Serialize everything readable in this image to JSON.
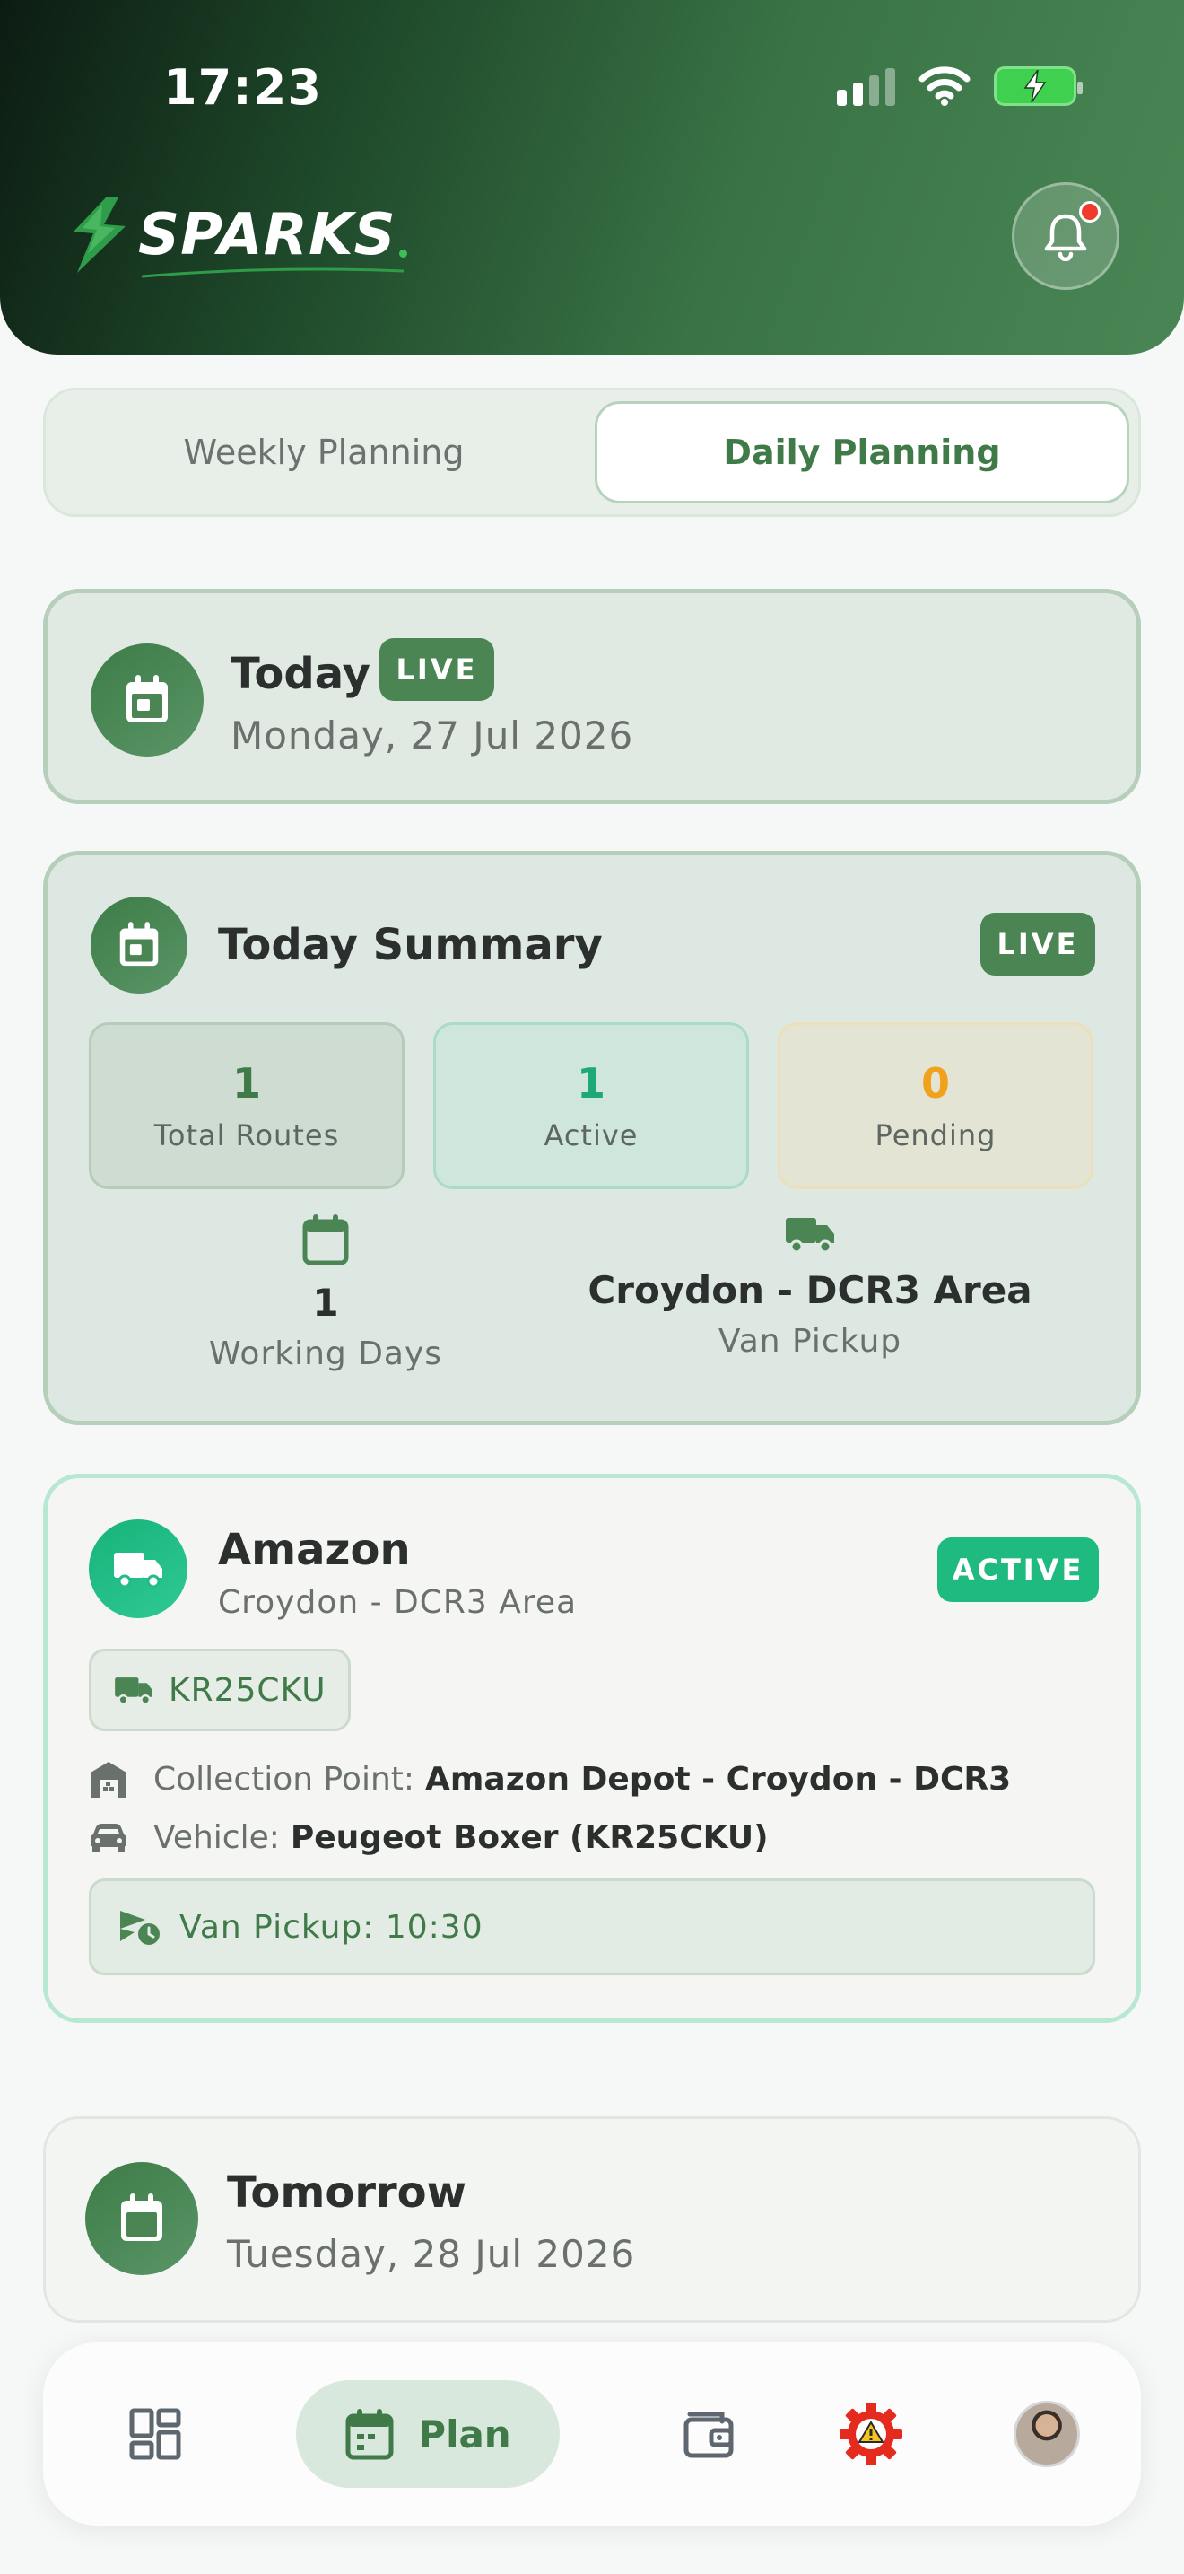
{
  "status_bar": {
    "time": "17:23"
  },
  "header": {
    "logo_text": "SPARKS",
    "has_notification": true
  },
  "tabs": [
    {
      "label": "Weekly Planning",
      "selected": false
    },
    {
      "label": "Daily Planning",
      "selected": true
    }
  ],
  "today": {
    "title": "Today",
    "badge": "LIVE",
    "date": "Monday, 27 Jul 2026"
  },
  "summary": {
    "title": "Today Summary",
    "badge": "LIVE",
    "stats": [
      {
        "value": "1",
        "label": "Total Routes",
        "color": "#3f7a48"
      },
      {
        "value": "1",
        "label": "Active",
        "color": "#1fa877"
      },
      {
        "value": "0",
        "label": "Pending",
        "color": "#f0a21c"
      }
    ],
    "working_days": {
      "value": "1",
      "label": "Working Days"
    },
    "van_pickup": {
      "value": "Croydon - DCR3 Area",
      "label": "Van Pickup"
    }
  },
  "route": {
    "company": "Amazon",
    "area": "Croydon - DCR3 Area",
    "status": "ACTIVE",
    "plate": "KR25CKU",
    "collection_label": "Collection Point:",
    "collection_value": "Amazon Depot - Croydon - DCR3",
    "vehicle_label": "Vehicle:",
    "vehicle_value": "Peugeot Boxer (KR25CKU)",
    "pickup": "Van Pickup: 10:30"
  },
  "tomorrow": {
    "title": "Tomorrow",
    "date": "Tuesday, 28 Jul 2026"
  },
  "bottom_nav": [
    {
      "icon": "dashboard-icon",
      "label": ""
    },
    {
      "icon": "calendar-icon",
      "label": "Plan",
      "selected": true
    },
    {
      "icon": "wallet-icon",
      "label": ""
    },
    {
      "icon": "warning-gear-icon",
      "label": ""
    },
    {
      "icon": "avatar",
      "label": ""
    }
  ],
  "colors": {
    "brand_green": "#3f7a48",
    "active_teal": "#1fba80",
    "pending_amber": "#f0a21c",
    "notification_red": "#ef3b2d"
  }
}
